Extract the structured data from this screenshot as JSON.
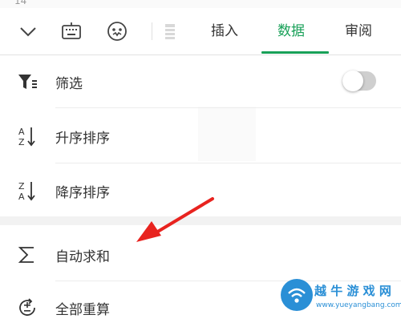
{
  "sheet": {
    "row_number": "14"
  },
  "toolbar": {
    "icons": [
      "chevron-down-icon",
      "keyboard-icon",
      "smiley-icon",
      "format-icon"
    ],
    "tabs": [
      {
        "label": "插入",
        "active": false
      },
      {
        "label": "数据",
        "active": true
      },
      {
        "label": "审阅",
        "active": false
      }
    ],
    "accent_color": "#18a058"
  },
  "menu": {
    "items": [
      {
        "label": "筛选",
        "icon": "filter-icon",
        "toggle": {
          "on": false
        }
      },
      {
        "label": "升序排序",
        "icon": "sort-ascending-icon"
      },
      {
        "label": "降序排序",
        "icon": "sort-descending-icon"
      },
      {
        "label": "自动求和",
        "icon": "sigma-icon"
      },
      {
        "label": "全部重算",
        "icon": "recalculate-icon"
      }
    ]
  },
  "annotation": {
    "arrow_color": "#e8231f"
  },
  "watermark": {
    "title": "越 牛 游 戏 网",
    "site": "www.yueyangbang.com"
  }
}
